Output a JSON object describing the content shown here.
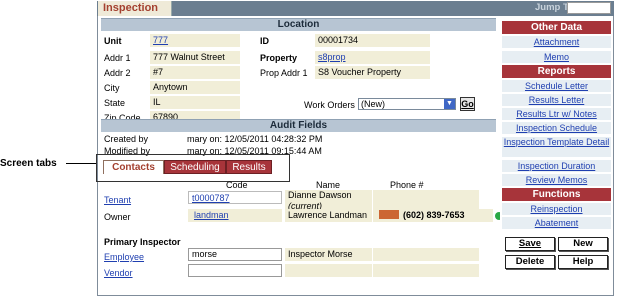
{
  "window": {
    "tab_title": "Inspection",
    "jump_to_label": "Jump To",
    "jump_to_value": ""
  },
  "callout": {
    "label": "Screen tabs"
  },
  "location": {
    "header": "Location",
    "unit_label": "Unit",
    "unit_value": "777",
    "addr1_label": "Addr 1",
    "addr1_value": "777 Walnut Street",
    "addr2_label": "Addr 2",
    "addr2_value": "#7",
    "city_label": "City",
    "city_value": "Anytown",
    "state_label": "State",
    "state_value": "IL",
    "zip_label": "Zip Code",
    "zip_value": "67890",
    "id_label": "ID",
    "id_value": "00001734",
    "property_label": "Property",
    "property_value": "s8prop",
    "prop_addr_label": "Prop Addr 1",
    "prop_addr_value": "S8 Voucher Property",
    "work_orders_label": "Work Orders",
    "work_orders_value": "(New)",
    "go_label": "Go"
  },
  "audit": {
    "header": "Audit Fields",
    "created_label": "Created by",
    "created_value": "mary on: 12/05/2011 04:28:32 PM",
    "modified_label": "Modified by",
    "modified_value": "mary on: 12/05/2011 09:15:44 AM"
  },
  "tabs": [
    {
      "label": "Contacts"
    },
    {
      "label": "Scheduling"
    },
    {
      "label": "Results"
    }
  ],
  "contacts": {
    "columns": {
      "code": "Code",
      "name": "Name",
      "phone": "Phone #"
    },
    "rows": [
      {
        "role": "Tenant",
        "code": "t0000787",
        "name": "Dianne Dawson",
        "note": "(current)",
        "phone": ""
      },
      {
        "role": "Owner",
        "code": "landman",
        "name": "Lawrence Landman",
        "note": "",
        "phone": "(602) 839-7653"
      }
    ],
    "primary_inspector_label": "Primary Inspector",
    "employee_label": "Employee",
    "employee_value": "morse",
    "employee_name": "Inspector Morse",
    "vendor_label": "Vendor",
    "vendor_value": ""
  },
  "sidebar": {
    "other_data_header": "Other Data",
    "other_data_links": [
      "Attachment",
      "Memo"
    ],
    "reports_header": "Reports",
    "reports_links": [
      "Schedule Letter",
      "Results Letter",
      "Results Ltr w/ Notes",
      "Inspection Schedule",
      "Inspection Template Detail",
      "Inspection Duration",
      "Review Memos"
    ],
    "functions_header": "Functions",
    "functions_links": [
      "Reinspection",
      "Abatement"
    ]
  },
  "buttons": {
    "save": "Save",
    "new": "New",
    "delete": "Delete",
    "help": "Help"
  }
}
